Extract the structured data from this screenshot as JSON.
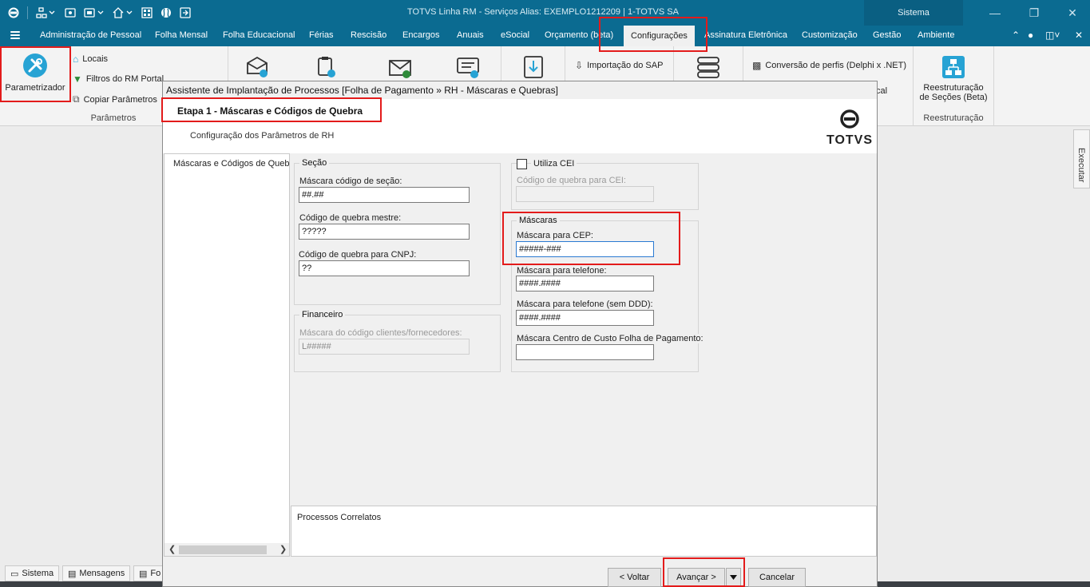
{
  "app": {
    "title": "TOTVS Linha RM - Serviços  Alias: EXEMPLO1212209 | 1-TOTVS SA",
    "system_label": "Sistema"
  },
  "menu": {
    "items": [
      "Administração de Pessoal",
      "Folha Mensal",
      "Folha Educacional",
      "Férias",
      "Rescisão",
      "Encargos",
      "Anuais",
      "eSocial",
      "Orçamento (beta)",
      "Configurações",
      "Assinatura Eletrônica",
      "Customização",
      "Gestão",
      "Ambiente"
    ],
    "active": "Configurações"
  },
  "ribbon": {
    "parametrizador": "Parametrizador",
    "locais": "Locais",
    "filtros": "Filtros do RM Portal",
    "copiar": "Copiar Parâmetros",
    "group_parametros": "Parâmetros",
    "importacao_sap": "Importação do SAP",
    "conversao": "Conversão de perfis (Delphi x .NET)",
    "cal_suffix": "cal",
    "reestruturacao_btn_line1": "Reestruturação",
    "reestruturacao_btn_line2": "de Seções (Beta)",
    "group_reestruturacao": "Reestruturação"
  },
  "side_tab": {
    "label": "Executar"
  },
  "statusbar": {
    "sistema": "Sistema",
    "mensagens": "Mensagens",
    "fo": "Fo"
  },
  "dialog": {
    "title": "Assistente de Implantação de Processos [Folha de Pagamento » RH - Máscaras e Quebras]",
    "step_title": "Etapa 1 - Máscaras e Códigos de Quebra",
    "step_subtitle": "Configuração dos Parâmetros de RH",
    "logo_text": "TOTVS",
    "tree_item": "Máscaras e Códigos de Quebra",
    "secao": {
      "legend": "Seção",
      "mascara_label": "Máscara código de seção:",
      "mascara_value": "##.##",
      "quebra_mestre_label": "Código de quebra mestre:",
      "quebra_mestre_value": "?????",
      "quebra_cnpj_label": "Código de quebra para CNPJ:",
      "quebra_cnpj_value": "??"
    },
    "financeiro": {
      "legend": "Financeiro",
      "mascara_label": "Máscara do código clientes/fornecedores:",
      "mascara_value": "L#####"
    },
    "cei": {
      "checkbox_label": "Utiliza CEI",
      "checked": false,
      "quebra_label": "Código de quebra para CEI:",
      "quebra_value": ""
    },
    "mascaras": {
      "legend": "Máscaras",
      "cep_label": "Máscara para CEP:",
      "cep_value": "#####-###",
      "telefone_label": "Máscara para telefone:",
      "telefone_value": "####.####",
      "telefone_sem_ddd_label": "Máscara para telefone (sem DDD):",
      "telefone_sem_ddd_value": "####.####",
      "centro_custo_label": "Máscara Centro de Custo Folha de Pagamento:",
      "centro_custo_value": ""
    },
    "processos_correlatos": "Processos Correlatos",
    "buttons": {
      "voltar": "< Voltar",
      "avancar": "Avançar >",
      "cancelar": "Cancelar"
    }
  },
  "colors": {
    "titlebar": "#0b6b91",
    "accent": "#27a3d4",
    "highlight": "#e31b1b"
  }
}
